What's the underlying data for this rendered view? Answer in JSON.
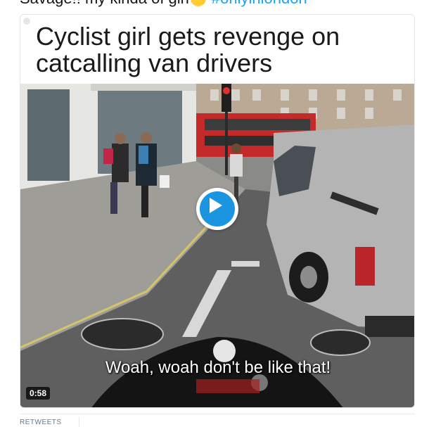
{
  "tweet": {
    "text": "Savage!! my kinda of girl",
    "emoji": "ok-hand",
    "hashtag": "#onlyinlondon",
    "hashtag_color": "#1da1f2"
  },
  "media": {
    "headline": "Cyclist girl gets revenge on catcalling van drivers",
    "subtitle": "Woah, woah don't be like that!",
    "duration": "0:58",
    "play_color": "#1b95e0"
  },
  "stats": {
    "retweets_label": "RETWEETS"
  }
}
